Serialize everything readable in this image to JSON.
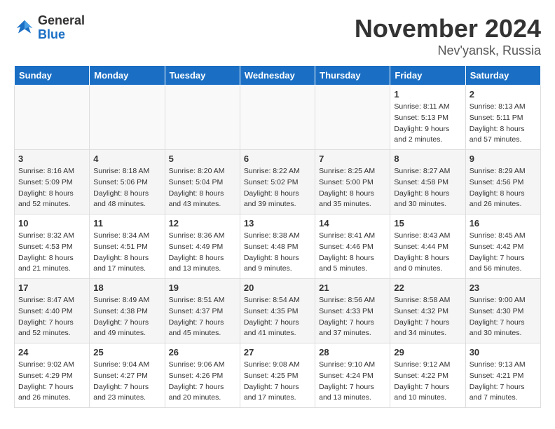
{
  "header": {
    "logo_line1": "General",
    "logo_line2": "Blue",
    "month": "November 2024",
    "location": "Nev'yansk, Russia"
  },
  "weekdays": [
    "Sunday",
    "Monday",
    "Tuesday",
    "Wednesday",
    "Thursday",
    "Friday",
    "Saturday"
  ],
  "weeks": [
    [
      {
        "day": "",
        "info": ""
      },
      {
        "day": "",
        "info": ""
      },
      {
        "day": "",
        "info": ""
      },
      {
        "day": "",
        "info": ""
      },
      {
        "day": "",
        "info": ""
      },
      {
        "day": "1",
        "info": "Sunrise: 8:11 AM\nSunset: 5:13 PM\nDaylight: 9 hours\nand 2 minutes."
      },
      {
        "day": "2",
        "info": "Sunrise: 8:13 AM\nSunset: 5:11 PM\nDaylight: 8 hours\nand 57 minutes."
      }
    ],
    [
      {
        "day": "3",
        "info": "Sunrise: 8:16 AM\nSunset: 5:09 PM\nDaylight: 8 hours\nand 52 minutes."
      },
      {
        "day": "4",
        "info": "Sunrise: 8:18 AM\nSunset: 5:06 PM\nDaylight: 8 hours\nand 48 minutes."
      },
      {
        "day": "5",
        "info": "Sunrise: 8:20 AM\nSunset: 5:04 PM\nDaylight: 8 hours\nand 43 minutes."
      },
      {
        "day": "6",
        "info": "Sunrise: 8:22 AM\nSunset: 5:02 PM\nDaylight: 8 hours\nand 39 minutes."
      },
      {
        "day": "7",
        "info": "Sunrise: 8:25 AM\nSunset: 5:00 PM\nDaylight: 8 hours\nand 35 minutes."
      },
      {
        "day": "8",
        "info": "Sunrise: 8:27 AM\nSunset: 4:58 PM\nDaylight: 8 hours\nand 30 minutes."
      },
      {
        "day": "9",
        "info": "Sunrise: 8:29 AM\nSunset: 4:56 PM\nDaylight: 8 hours\nand 26 minutes."
      }
    ],
    [
      {
        "day": "10",
        "info": "Sunrise: 8:32 AM\nSunset: 4:53 PM\nDaylight: 8 hours\nand 21 minutes."
      },
      {
        "day": "11",
        "info": "Sunrise: 8:34 AM\nSunset: 4:51 PM\nDaylight: 8 hours\nand 17 minutes."
      },
      {
        "day": "12",
        "info": "Sunrise: 8:36 AM\nSunset: 4:49 PM\nDaylight: 8 hours\nand 13 minutes."
      },
      {
        "day": "13",
        "info": "Sunrise: 8:38 AM\nSunset: 4:48 PM\nDaylight: 8 hours\nand 9 minutes."
      },
      {
        "day": "14",
        "info": "Sunrise: 8:41 AM\nSunset: 4:46 PM\nDaylight: 8 hours\nand 5 minutes."
      },
      {
        "day": "15",
        "info": "Sunrise: 8:43 AM\nSunset: 4:44 PM\nDaylight: 8 hours\nand 0 minutes."
      },
      {
        "day": "16",
        "info": "Sunrise: 8:45 AM\nSunset: 4:42 PM\nDaylight: 7 hours\nand 56 minutes."
      }
    ],
    [
      {
        "day": "17",
        "info": "Sunrise: 8:47 AM\nSunset: 4:40 PM\nDaylight: 7 hours\nand 52 minutes."
      },
      {
        "day": "18",
        "info": "Sunrise: 8:49 AM\nSunset: 4:38 PM\nDaylight: 7 hours\nand 49 minutes."
      },
      {
        "day": "19",
        "info": "Sunrise: 8:51 AM\nSunset: 4:37 PM\nDaylight: 7 hours\nand 45 minutes."
      },
      {
        "day": "20",
        "info": "Sunrise: 8:54 AM\nSunset: 4:35 PM\nDaylight: 7 hours\nand 41 minutes."
      },
      {
        "day": "21",
        "info": "Sunrise: 8:56 AM\nSunset: 4:33 PM\nDaylight: 7 hours\nand 37 minutes."
      },
      {
        "day": "22",
        "info": "Sunrise: 8:58 AM\nSunset: 4:32 PM\nDaylight: 7 hours\nand 34 minutes."
      },
      {
        "day": "23",
        "info": "Sunrise: 9:00 AM\nSunset: 4:30 PM\nDaylight: 7 hours\nand 30 minutes."
      }
    ],
    [
      {
        "day": "24",
        "info": "Sunrise: 9:02 AM\nSunset: 4:29 PM\nDaylight: 7 hours\nand 26 minutes."
      },
      {
        "day": "25",
        "info": "Sunrise: 9:04 AM\nSunset: 4:27 PM\nDaylight: 7 hours\nand 23 minutes."
      },
      {
        "day": "26",
        "info": "Sunrise: 9:06 AM\nSunset: 4:26 PM\nDaylight: 7 hours\nand 20 minutes."
      },
      {
        "day": "27",
        "info": "Sunrise: 9:08 AM\nSunset: 4:25 PM\nDaylight: 7 hours\nand 17 minutes."
      },
      {
        "day": "28",
        "info": "Sunrise: 9:10 AM\nSunset: 4:24 PM\nDaylight: 7 hours\nand 13 minutes."
      },
      {
        "day": "29",
        "info": "Sunrise: 9:12 AM\nSunset: 4:22 PM\nDaylight: 7 hours\nand 10 minutes."
      },
      {
        "day": "30",
        "info": "Sunrise: 9:13 AM\nSunset: 4:21 PM\nDaylight: 7 hours\nand 7 minutes."
      }
    ]
  ]
}
